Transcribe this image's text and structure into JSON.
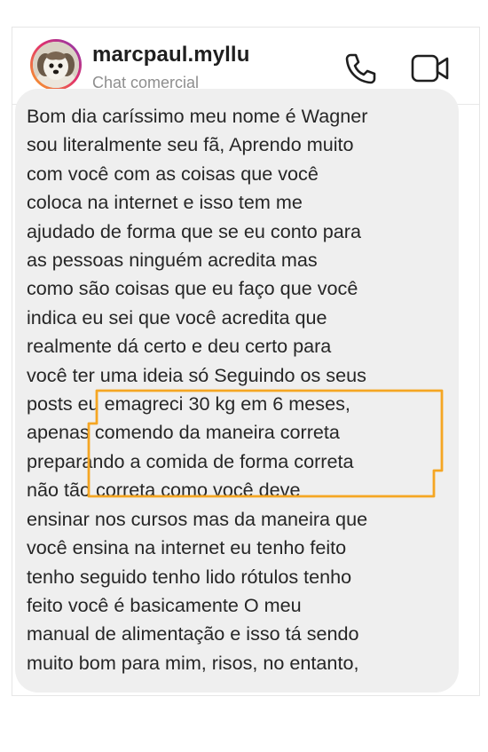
{
  "header": {
    "username": "marcpaul.myllu",
    "subtitle": "Chat comercial",
    "avatar_icon": "dog-avatar-icon",
    "call_icon": "phone-icon",
    "video_icon": "video-camera-icon"
  },
  "message": {
    "lines": [
      "Bom dia caríssimo meu nome é Wagner",
      "sou literalmente seu fã, Aprendo muito",
      "com você com as coisas que você",
      "coloca na internet e isso tem me",
      "ajudado de forma que se eu conto para",
      "as pessoas ninguém acredita mas",
      "como são coisas que eu faço que você",
      "indica eu sei que você acredita que",
      "realmente dá certo e deu certo para",
      "você ter uma ideia só Seguindo os seus",
      "posts eu emagreci 30 kg em 6 meses,",
      "apenas comendo da maneira correta",
      "preparando a comida de forma correta",
      "não tão correta como você deve",
      "ensinar nos cursos mas da maneira que",
      "você ensina na internet eu tenho feito",
      "tenho seguido tenho lido rótulos tenho",
      "feito você é basicamente O meu",
      "manual de alimentação e isso tá sendo",
      "muito bom para mim, risos, no entanto,"
    ]
  },
  "colors": {
    "highlight": "#f5a623",
    "bubble": "#efefef",
    "text": "#262626",
    "subtitle": "#8e8e8e"
  }
}
